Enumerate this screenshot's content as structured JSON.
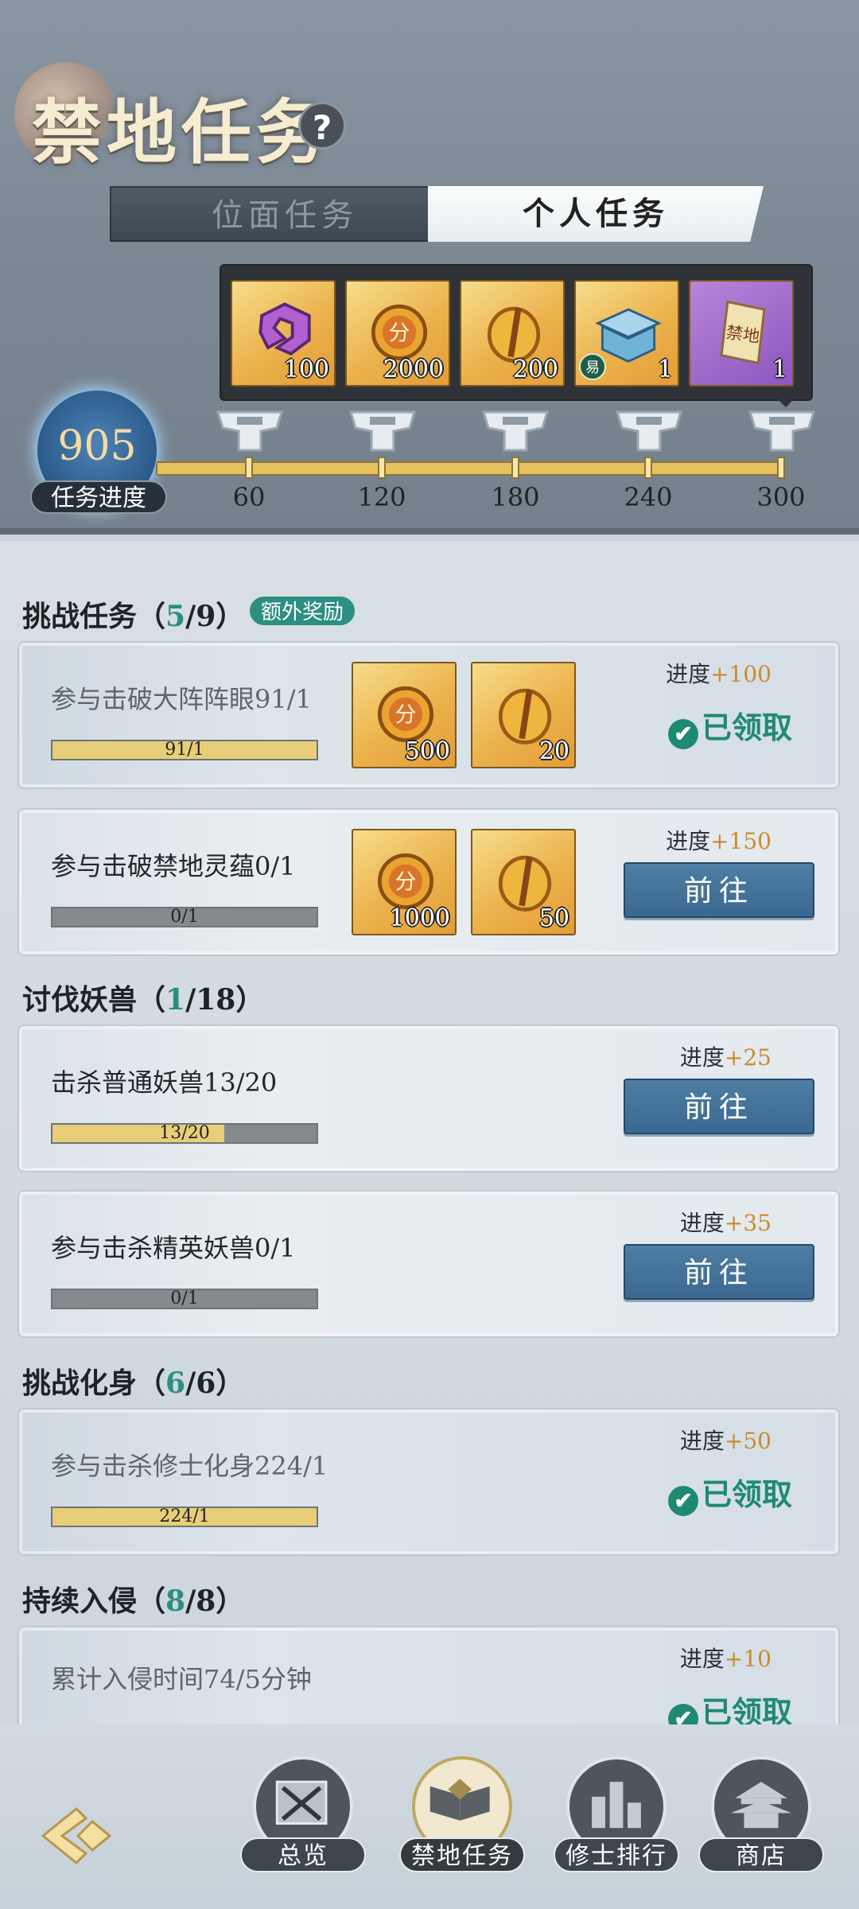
{
  "header": {
    "title": "禁地任务",
    "help_label": "?"
  },
  "tabs": [
    {
      "label": "位面任务",
      "active": false
    },
    {
      "label": "个人任务",
      "active": true
    }
  ],
  "rewards": [
    {
      "icon": "purple-hook-fragment-icon",
      "count": "100",
      "style": "gold"
    },
    {
      "icon": "dragon-coin-icon",
      "count": "2000",
      "style": "gold"
    },
    {
      "icon": "golden-sword-token-icon",
      "count": "200",
      "style": "gold"
    },
    {
      "icon": "blue-treasure-chest-icon",
      "count": "1",
      "style": "gold",
      "badge": "易"
    },
    {
      "icon": "forbidden-land-scroll-icon",
      "count": "1",
      "style": "purple"
    }
  ],
  "progress": {
    "value": "905",
    "label": "任务进度",
    "milestones": [
      "60",
      "120",
      "180",
      "240",
      "300"
    ],
    "fraction": 1.0
  },
  "sections": [
    {
      "title_prefix": "挑战任务（",
      "done": "5",
      "total": "/9",
      "suffix": "）",
      "extra": "额外奖励"
    },
    {
      "title_prefix": "讨伐妖兽（",
      "done": "1",
      "total": "/18",
      "suffix": "）"
    },
    {
      "title_prefix": "挑战化身（",
      "done": "6",
      "total": "/6",
      "suffix": "）"
    },
    {
      "title_prefix": "持续入侵（",
      "done": "8",
      "total": "/8",
      "suffix": "）"
    }
  ],
  "tasks": [
    {
      "name": "参与击破大阵阵眼91/1",
      "bar": "91/1",
      "fill": 1.0,
      "reward1": "500",
      "reward2": "20",
      "progress_label": "进度",
      "progress_gain": "+100",
      "status": "已领取"
    },
    {
      "name": "参与击破禁地灵蕴0/1",
      "bar": "0/1",
      "fill": 0.0,
      "reward1": "1000",
      "reward2": "50",
      "progress_label": "进度",
      "progress_gain": "+150",
      "status": "前往"
    },
    {
      "name": "击杀普通妖兽13/20",
      "bar": "13/20",
      "fill": 0.65,
      "progress_label": "进度",
      "progress_gain": "+25",
      "status": "前往"
    },
    {
      "name": "参与击杀精英妖兽0/1",
      "bar": "0/1",
      "fill": 0.0,
      "progress_label": "进度",
      "progress_gain": "+35",
      "status": "前往"
    },
    {
      "name": "参与击杀修士化身224/1",
      "bar": "224/1",
      "fill": 1.0,
      "progress_label": "进度",
      "progress_gain": "+50",
      "status": "已领取"
    },
    {
      "name": "累计入侵时间74/5分钟",
      "progress_label": "进度",
      "progress_gain": "+10",
      "status": "已领取"
    }
  ],
  "nav": [
    {
      "label": "总览",
      "icon": "crossed-swords-map-icon"
    },
    {
      "label": "禁地任务",
      "icon": "open-book-icon",
      "active": true
    },
    {
      "label": "修士排行",
      "icon": "ranking-towers-icon"
    },
    {
      "label": "商店",
      "icon": "pavilion-shop-icon"
    }
  ],
  "check_glyph": "✔"
}
